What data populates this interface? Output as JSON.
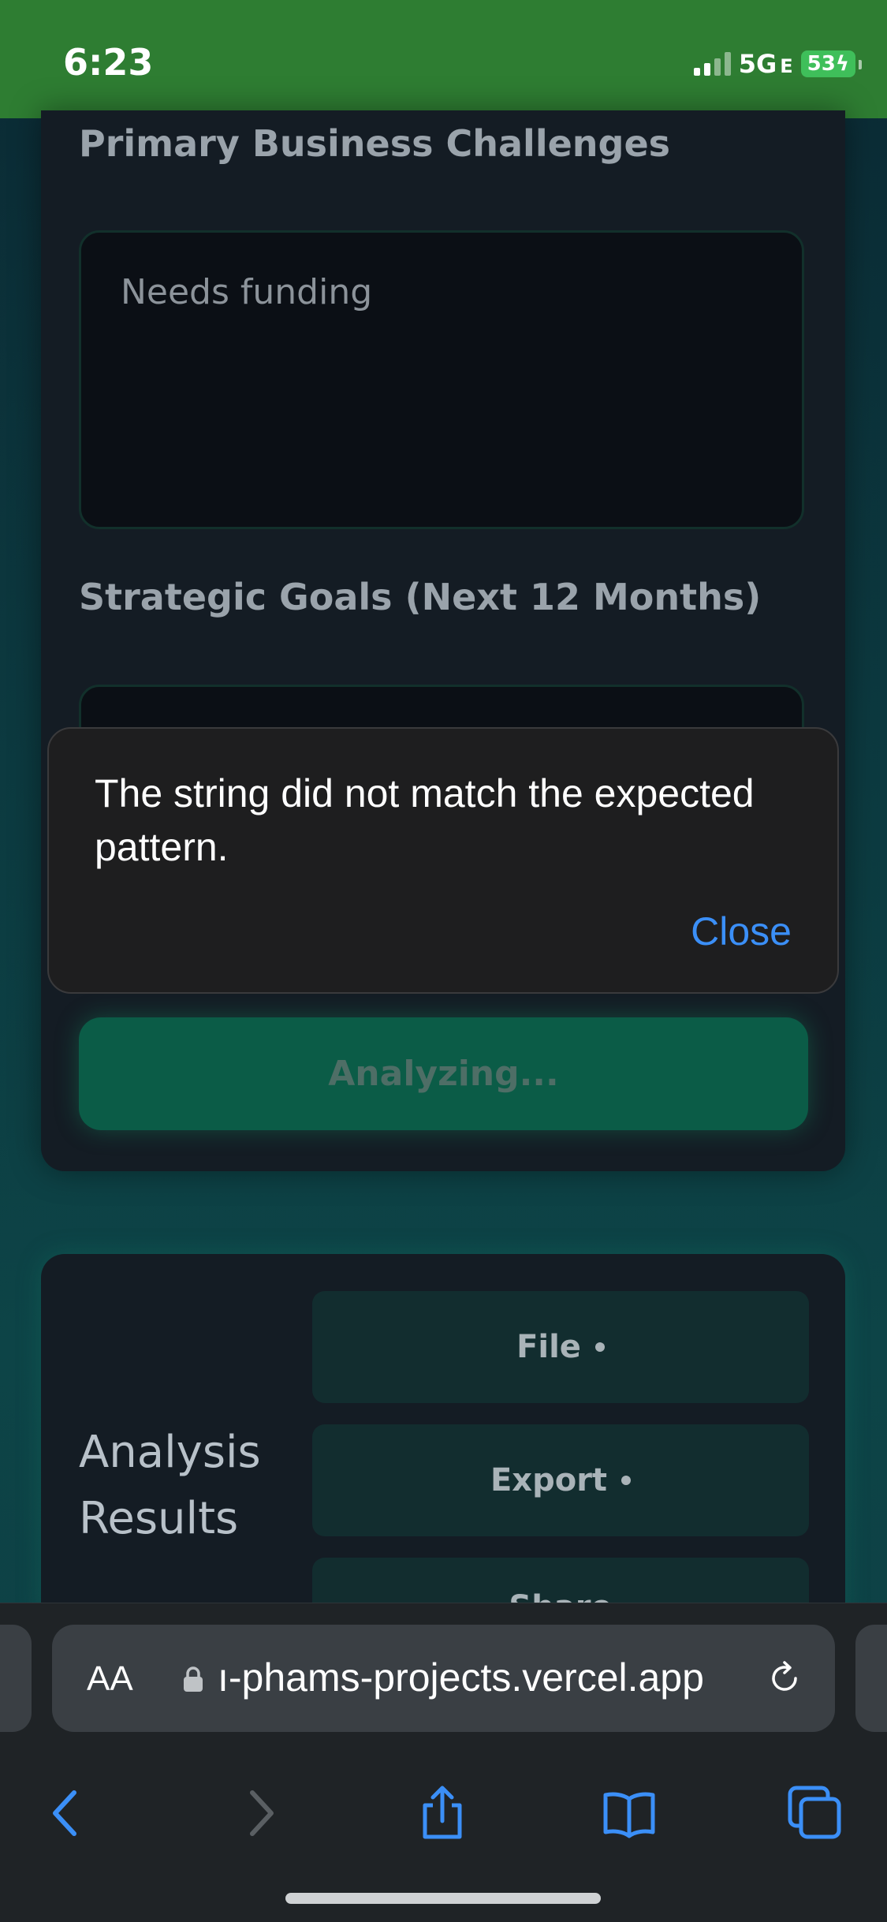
{
  "status_bar": {
    "time": "6:23",
    "network": "5G",
    "network_suffix": "E",
    "battery": "53"
  },
  "form": {
    "challenges_label": "Primary Business Challenges",
    "challenges_value": "Needs funding",
    "goals_label": "Strategic Goals (Next 12 Months)",
    "analyze_button": "Analyzing..."
  },
  "alert": {
    "message": "The string did not match the expected pattern.",
    "close_label": "Close"
  },
  "results": {
    "title_line1": "Analysis",
    "title_line2": "Results",
    "buttons": [
      {
        "label": "File"
      },
      {
        "label": "Export"
      },
      {
        "label": "Share"
      }
    ]
  },
  "browser": {
    "aa_label": "AA",
    "url": "ı-phams-projects.vercel.app"
  },
  "icons": {
    "back": "chevron-left-icon",
    "forward": "chevron-right-icon",
    "share": "share-icon",
    "bookmarks": "book-icon",
    "tabs": "tabs-icon"
  },
  "colors": {
    "status_bar": "#2e7d32",
    "accent_link": "#3b8ff7",
    "analyze_button": "#0b5c47"
  }
}
